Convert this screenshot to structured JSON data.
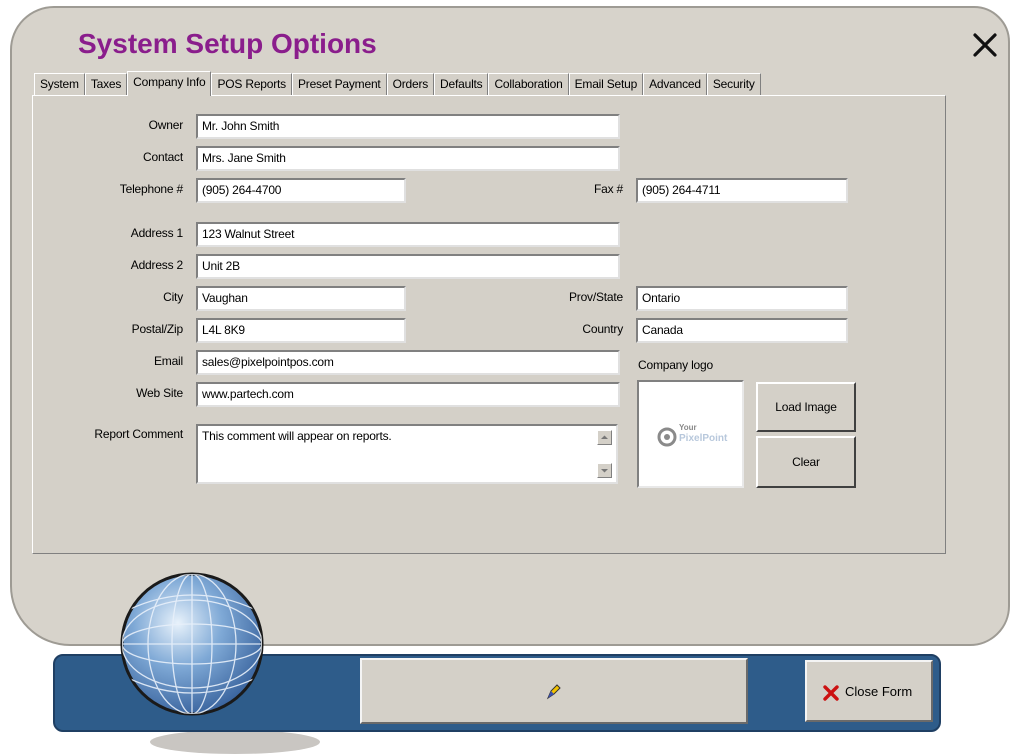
{
  "window": {
    "title": "System Setup Options"
  },
  "tabs": [
    {
      "label": "System"
    },
    {
      "label": "Taxes"
    },
    {
      "label": "Company Info",
      "active": true
    },
    {
      "label": "POS Reports"
    },
    {
      "label": "Preset Payment"
    },
    {
      "label": "Orders"
    },
    {
      "label": "Defaults"
    },
    {
      "label": "Collaboration"
    },
    {
      "label": "Email Setup"
    },
    {
      "label": "Advanced"
    },
    {
      "label": "Security"
    }
  ],
  "form": {
    "owner": {
      "label": "Owner",
      "value": "Mr. John Smith"
    },
    "contact": {
      "label": "Contact",
      "value": "Mrs. Jane Smith"
    },
    "telephone": {
      "label": "Telephone #",
      "value": "(905) 264-4700"
    },
    "fax": {
      "label": "Fax #",
      "value": "(905) 264-4711"
    },
    "address1": {
      "label": "Address 1",
      "value": "123 Walnut Street"
    },
    "address2": {
      "label": "Address 2",
      "value": "Unit 2B"
    },
    "city": {
      "label": "City",
      "value": "Vaughan"
    },
    "prov_state": {
      "label": "Prov/State",
      "value": "Ontario"
    },
    "postal_zip": {
      "label": "Postal/Zip",
      "value": "L4L 8K9"
    },
    "country": {
      "label": "Country",
      "value": "Canada"
    },
    "email": {
      "label": "Email",
      "value": "sales@pixelpointpos.com"
    },
    "website": {
      "label": "Web Site",
      "value": "www.partech.com"
    },
    "report_comment": {
      "label": "Report Comment",
      "value": "This comment will appear on reports."
    }
  },
  "logo": {
    "label": "Company logo",
    "text_top": "Your",
    "text_bottom": "PixelPoint",
    "load_button": "Load Image",
    "clear_button": "Clear"
  },
  "bottom": {
    "close_label": "Close Form"
  },
  "colors": {
    "title": "#8a1d8c",
    "bar": "#2e5c8a",
    "close_x": "#cc1111"
  }
}
